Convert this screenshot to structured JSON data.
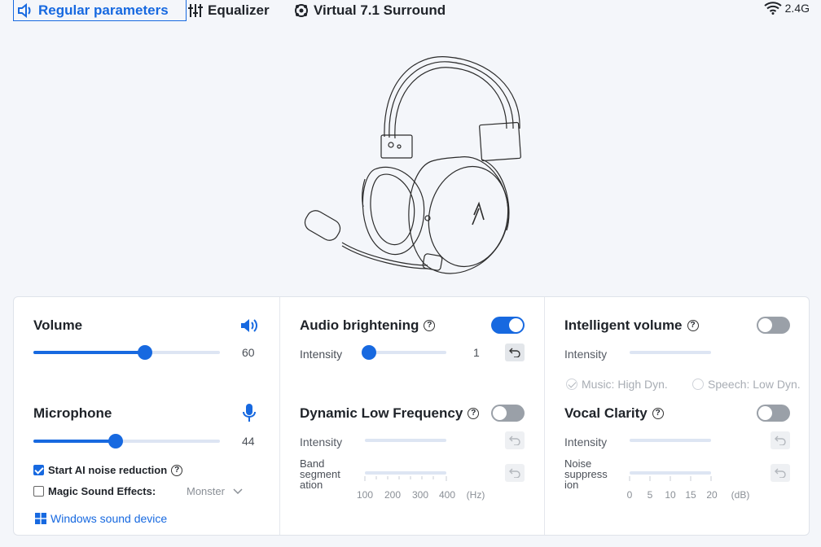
{
  "tabs": [
    {
      "label": "Regular parameters",
      "icon": "speaker-icon",
      "active": true
    },
    {
      "label": "Equalizer",
      "icon": "equalizer-sliders-icon",
      "active": false
    },
    {
      "label": "Virtual 7.1 Surround",
      "icon": "surround-icon",
      "active": false
    }
  ],
  "connection": {
    "label": "2.4G",
    "icon": "wifi-icon"
  },
  "volume": {
    "title": "Volume",
    "value": "60",
    "level_fraction": 0.6
  },
  "microphone": {
    "title": "Microphone",
    "value": "44",
    "level_fraction": 0.44,
    "ai_noise_label": "Start AI noise reduction",
    "ai_noise_checked": true,
    "magic_label": "Magic Sound Effects:",
    "magic_checked": false,
    "magic_selected": "Monster",
    "windows_link": "Windows sound device"
  },
  "audio_brightening": {
    "title": "Audio brightening",
    "enabled": true,
    "intensity_label": "Intensity",
    "value": "1",
    "level_fraction": 0.05
  },
  "dynamic_low_frequency": {
    "title": "Dynamic Low Frequency",
    "enabled": false,
    "intensity_label": "Intensity",
    "band_label_1": "Band",
    "band_label_2": "segment",
    "band_label_3": "ation",
    "band_ticks": [
      "100",
      "200",
      "300",
      "400"
    ],
    "band_unit": "(Hz)"
  },
  "intelligent_volume": {
    "title": "Intelligent volume",
    "enabled": false,
    "intensity_label": "Intensity",
    "option_music": "Music: High Dyn.",
    "option_speech": "Speech: Low Dyn.",
    "selected": "music"
  },
  "vocal_clarity": {
    "title": "Vocal Clarity",
    "enabled": false,
    "intensity_label": "Intensity",
    "noise_label_1": "Noise",
    "noise_label_2": "suppress",
    "noise_label_3": "ion",
    "noise_ticks": [
      "0",
      "5",
      "10",
      "15",
      "20"
    ],
    "noise_unit": "(dB)"
  },
  "colors": {
    "accent": "#1769e0",
    "toggle_off": "#9aa0a8",
    "track": "#dde5f3"
  }
}
